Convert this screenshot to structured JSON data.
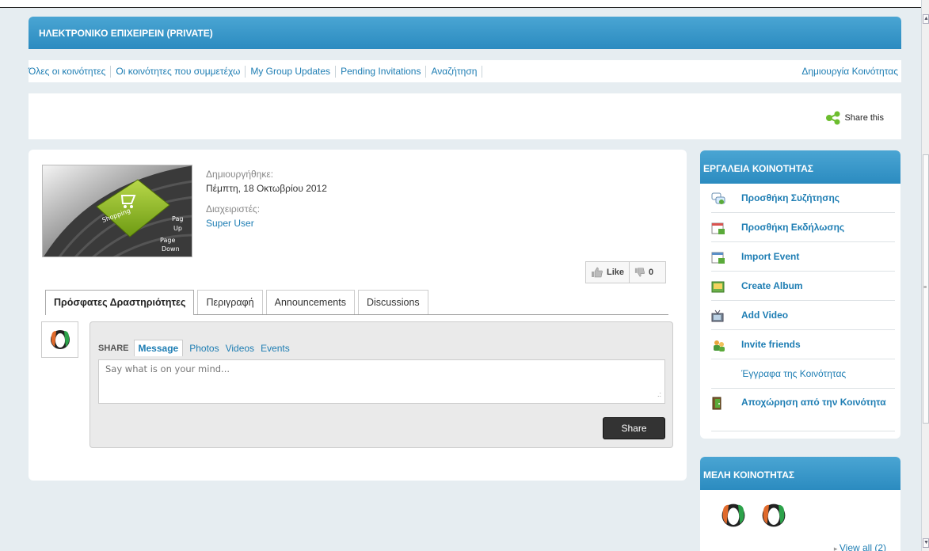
{
  "page": {
    "title": "ΗΛΕΚΤΡΟΝΙΚΟ ΕΠΙΧΕΙΡΕΙΝ (PRIVATE)"
  },
  "nav": {
    "items": [
      {
        "label": "Όλες οι κοινότητες"
      },
      {
        "label": "Οι κοινότητες που συμμετέχω"
      },
      {
        "label": "My Group Updates"
      },
      {
        "label": "Pending Invitations"
      },
      {
        "label": "Αναζήτηση"
      }
    ],
    "create_label": "Δημιουργία Κοινότητας"
  },
  "share_this": {
    "label": "Share this",
    "icon": "share-icon"
  },
  "group": {
    "image": "group-avatar",
    "created_label": "Δημιουργήθηκε:",
    "created_value": "Πέμπτη, 18 Οκτωβρίου 2012",
    "admins_label": "Διαχειριστές:",
    "admin_name": "Super User",
    "like_label": "Like",
    "dislike_count": "0"
  },
  "tabs": [
    {
      "label": "Πρόσφατες Δραστηριότητες",
      "active": true
    },
    {
      "label": "Περιγραφή",
      "active": false
    },
    {
      "label": "Announcements",
      "active": false
    },
    {
      "label": "Discussions",
      "active": false
    }
  ],
  "composer": {
    "share_label": "SHARE",
    "options": [
      {
        "label": "Message",
        "active": true
      },
      {
        "label": "Photos",
        "active": false
      },
      {
        "label": "Videos",
        "active": false
      },
      {
        "label": "Events",
        "active": false
      }
    ],
    "placeholder": "Say what is on your mind...",
    "button_label": "Share"
  },
  "tools": {
    "title": "ΕΡΓΑΛΕΙΑ ΚΟΙΝΟΤΗΤΑΣ",
    "items": [
      {
        "label": "Προσθήκη Συζήτησης",
        "icon": "discussion-icon"
      },
      {
        "label": "Προσθήκη Εκδήλωσης",
        "icon": "calendar-icon"
      },
      {
        "label": "Import Event",
        "icon": "calendar-import-icon"
      },
      {
        "label": "Create Album",
        "icon": "album-icon"
      },
      {
        "label": "Add Video",
        "icon": "video-icon"
      },
      {
        "label": "Invite friends",
        "icon": "invite-icon"
      },
      {
        "label": "Έγγραφα της Κοινότητας",
        "icon": ""
      },
      {
        "label": "Αποχώρηση από την Κοινότητα",
        "icon": "exit-door-icon"
      }
    ]
  },
  "members": {
    "title": "ΜΕΛΗ ΚΟΙΝΟΤΗΤΑΣ",
    "view_all": "View all (2)"
  },
  "colors": {
    "accent": "#2b8bc0",
    "link": "#1d7db3",
    "background": "#e6edf1"
  }
}
